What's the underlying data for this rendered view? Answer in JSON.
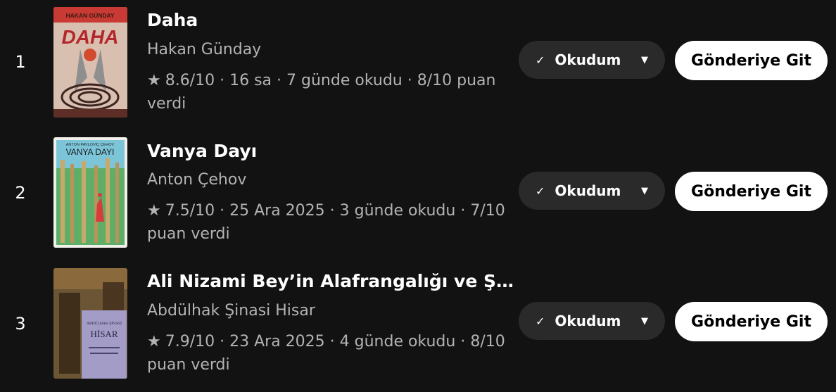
{
  "books": [
    {
      "rank": "1",
      "title": "Daha",
      "author": "Hakan Günday",
      "meta_line1": "8.6/10 · 16 sa · 7 günde okudu · 8/10 puan",
      "meta_line2": "verdi",
      "status": "Okudum",
      "action": "Gönderiye Git",
      "cover_text_top": "HAKAN GÜNDAY",
      "cover_text_main": "DAHA"
    },
    {
      "rank": "2",
      "title": "Vanya Dayı",
      "author": "Anton Çehov",
      "meta_line1": "7.5/10 · 25 Ara 2025 · 3 günde okudu · 7/10",
      "meta_line2": "puan verdi",
      "status": "Okudum",
      "action": "Gönderiye Git",
      "cover_text_top": "ANTON PAVLOVİÇ ÇEHOV",
      "cover_text_main": "VANYA DAYI"
    },
    {
      "rank": "3",
      "title": "Ali Nizami Bey’in Alafrangalığı ve Şey...",
      "author": "Abdülhak Şinasi Hisar",
      "meta_line1": "7.9/10 · 23 Ara 2025 · 4 günde okudu · 8/10",
      "meta_line2": "puan verdi",
      "status": "Okudum",
      "action": "Gönderiye Git",
      "cover_text_top": "ABDÜLHAK ŞİNASİ",
      "cover_text_main": "HİSAR"
    }
  ],
  "icons": {
    "rating": "star-icon",
    "status": "check-icon",
    "dropdown": "chevron-down-icon"
  },
  "colors": {
    "background": "#121212",
    "secondary_text": "#b3b3b3",
    "status_button": "#2a2a2a",
    "action_button": "#ffffff"
  }
}
